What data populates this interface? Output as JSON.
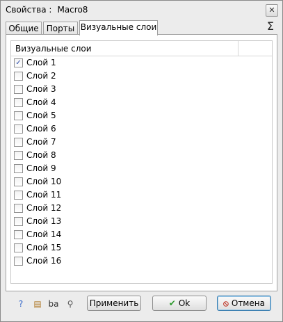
{
  "window": {
    "title_prefix": "Свойства :",
    "title_object": "Macro8",
    "close_glyph": "✕"
  },
  "tabs": [
    {
      "label": "Общие",
      "active": false
    },
    {
      "label": "Порты",
      "active": false
    },
    {
      "label": "Визуальные слои",
      "active": true
    }
  ],
  "sigma_glyph": "Σ",
  "list": {
    "header": "Визуальные слои",
    "rows": [
      {
        "label": "Слой 1",
        "checked": true
      },
      {
        "label": "Слой 2",
        "checked": false
      },
      {
        "label": "Слой 3",
        "checked": false
      },
      {
        "label": "Слой 4",
        "checked": false
      },
      {
        "label": "Слой 5",
        "checked": false
      },
      {
        "label": "Слой 6",
        "checked": false
      },
      {
        "label": "Слой 7",
        "checked": false
      },
      {
        "label": "Слой 8",
        "checked": false
      },
      {
        "label": "Слой 9",
        "checked": false
      },
      {
        "label": "Слой 10",
        "checked": false
      },
      {
        "label": "Слой 11",
        "checked": false
      },
      {
        "label": "Слой 12",
        "checked": false
      },
      {
        "label": "Слой 13",
        "checked": false
      },
      {
        "label": "Слой 14",
        "checked": false
      },
      {
        "label": "Слой 15",
        "checked": false
      },
      {
        "label": "Слой 16",
        "checked": false
      }
    ],
    "check_glyph": "✓"
  },
  "footer": {
    "icons": [
      {
        "name": "help-icon",
        "glyph": "?",
        "color": "#2f64c8"
      },
      {
        "name": "layers-icon",
        "glyph": "▤",
        "color": "#b07a2a"
      },
      {
        "name": "font-icon",
        "glyph": "ba",
        "color": "#333333"
      },
      {
        "name": "zoom-icon",
        "glyph": "⚲",
        "color": "#555555"
      }
    ],
    "apply_label": "Применить",
    "ok_label": "Ok",
    "ok_glyph": "✔",
    "ok_color": "#2f9a2f",
    "cancel_label": "Отмена",
    "cancel_glyph": "⦸",
    "cancel_color": "#c0392b"
  }
}
